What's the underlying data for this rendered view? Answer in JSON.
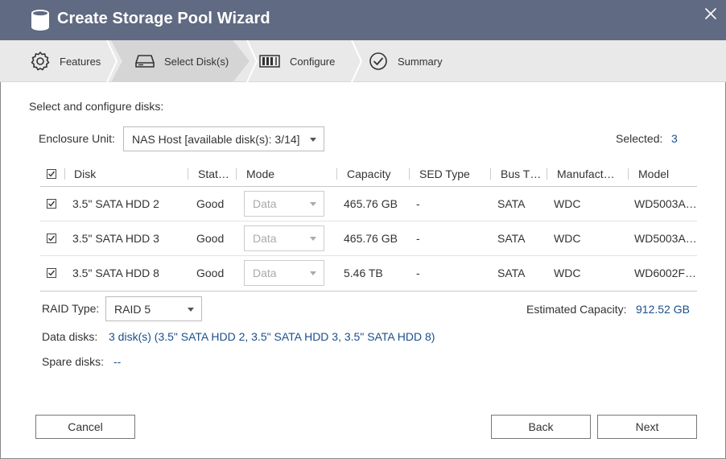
{
  "window": {
    "title": "Create Storage Pool Wizard",
    "close_icon": "close-icon",
    "title_icon": "database-icon"
  },
  "steps": [
    {
      "label": "Features",
      "icon": "gear-icon",
      "active": false
    },
    {
      "label": "Select Disk(s)",
      "icon": "hdd-icon",
      "active": true
    },
    {
      "label": "Configure",
      "icon": "raid-icon",
      "active": false
    },
    {
      "label": "Summary",
      "icon": "check-circle-icon",
      "active": false
    }
  ],
  "section_title": "Select and configure disks:",
  "enclosure": {
    "label": "Enclosure Unit:",
    "value": "NAS Host [available disk(s): 3/14]"
  },
  "selected": {
    "label": "Selected:",
    "count": "3"
  },
  "table": {
    "columns": [
      "Disk",
      "Stat…",
      "Mode",
      "Capacity",
      "SED Type",
      "Bus T…",
      "Manufact…",
      "Model"
    ],
    "rows": [
      {
        "checked": true,
        "disk": "3.5\" SATA HDD 2",
        "status": "Good",
        "mode": "Data",
        "capacity": "465.76 GB",
        "sed": "-",
        "bus": "SATA",
        "manufacturer": "WDC",
        "model": "WD5003A…"
      },
      {
        "checked": true,
        "disk": "3.5\" SATA HDD 3",
        "status": "Good",
        "mode": "Data",
        "capacity": "465.76 GB",
        "sed": "-",
        "bus": "SATA",
        "manufacturer": "WDC",
        "model": "WD5003A…"
      },
      {
        "checked": true,
        "disk": "3.5\" SATA HDD 8",
        "status": "Good",
        "mode": "Data",
        "capacity": "5.46 TB",
        "sed": "-",
        "bus": "SATA",
        "manufacturer": "WDC",
        "model": "WD6002F…"
      }
    ]
  },
  "raid": {
    "label": "RAID Type:",
    "value": "RAID 5"
  },
  "estimated": {
    "label": "Estimated Capacity:",
    "value": "912.52 GB"
  },
  "data_disks": {
    "label": "Data disks:",
    "value": "3 disk(s) (3.5\" SATA HDD 2, 3.5\" SATA HDD 3, 3.5\" SATA HDD 8)"
  },
  "spare_disks": {
    "label": "Spare disks:",
    "value": "--"
  },
  "buttons": {
    "cancel": "Cancel",
    "back": "Back",
    "next": "Next"
  },
  "colors": {
    "titlebar": "#606a82",
    "accent_text": "#1a4f8a",
    "steps_bg": "#e9e9e9",
    "active_step_bg": "#d5d5d5"
  }
}
